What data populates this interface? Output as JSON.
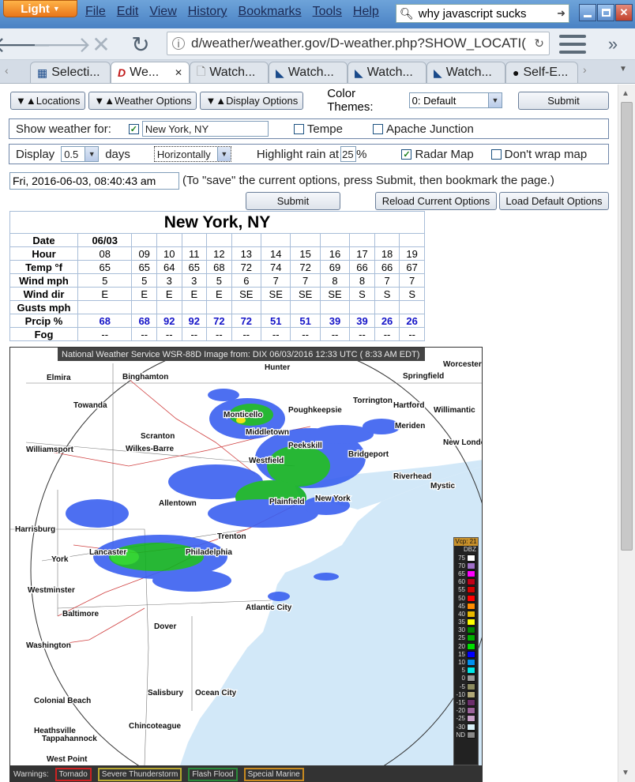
{
  "browser": {
    "theme_button": "Light",
    "menu": [
      "File",
      "Edit",
      "View",
      "History",
      "Bookmarks",
      "Tools",
      "Help"
    ],
    "search_text": "why javascript sucks",
    "url": "d/weather/weather.gov/D-weather.php?SHOW_LOCATI(",
    "tabs": [
      {
        "label": "Selecti...",
        "icon": "grid-icon"
      },
      {
        "label": "We...",
        "icon": "d-logo-icon",
        "active": true
      },
      {
        "label": "Watch...",
        "icon": "page-icon"
      },
      {
        "label": "Watch...",
        "icon": "trail-icon"
      },
      {
        "label": "Watch...",
        "icon": "trail-icon"
      },
      {
        "label": "Watch...",
        "icon": "trail-icon"
      },
      {
        "label": "Self-E...",
        "icon": "github-icon"
      }
    ]
  },
  "options": {
    "locations_btn": "▼▲Locations",
    "weather_options_btn": "▼▲Weather Options",
    "display_options_btn": "▼▲Display Options",
    "color_themes_label": "Color Themes:",
    "color_theme_value": "0: Default",
    "submit": "Submit",
    "show_weather_label": "Show weather for:",
    "location_value": "New York, NY",
    "loc_tempe": "Tempe",
    "loc_apache": "Apache Junction",
    "display_label": "Display",
    "days_value": "0.5",
    "days_label": "days",
    "orientation_value": "Horizontally",
    "highlight_label": "Highlight rain at",
    "highlight_value": "25",
    "percent": "%",
    "radar_map_label": "Radar Map",
    "dont_wrap_label": "Don't wrap map",
    "timestamp": "Fri, 2016-06-03, 08:40:43 am",
    "save_hint": "(To \"save\" the current options, press Submit, then bookmark the page.)",
    "submit2": "Submit",
    "reload_btn": "Reload Current Options",
    "load_default_btn": "Load Default Options"
  },
  "forecast": {
    "city": "New York, NY",
    "row_labels": [
      "Date",
      "Hour",
      "Temp °f",
      "Wind mph",
      "Wind dir",
      "Gusts mph",
      "Prcip %",
      "Fog"
    ],
    "date": "06/03",
    "hours": [
      "08",
      "09",
      "10",
      "11",
      "12",
      "13",
      "14",
      "15",
      "16",
      "17",
      "18",
      "19"
    ],
    "temp": [
      "65",
      "65",
      "64",
      "65",
      "68",
      "72",
      "74",
      "72",
      "69",
      "66",
      "66",
      "67"
    ],
    "wind_mph": [
      "5",
      "5",
      "3",
      "3",
      "5",
      "6",
      "7",
      "7",
      "8",
      "8",
      "7",
      "7"
    ],
    "wind_dir": [
      "E",
      "E",
      "E",
      "E",
      "E",
      "SE",
      "SE",
      "SE",
      "SE",
      "S",
      "S",
      "S"
    ],
    "gusts": [
      "",
      "",
      "",
      "",
      "",
      "",
      "",
      "",
      "",
      "",
      "",
      ""
    ],
    "precip": [
      "68",
      "68",
      "92",
      "92",
      "72",
      "72",
      "51",
      "51",
      "39",
      "39",
      "26",
      "26"
    ],
    "fog": [
      "--",
      "--",
      "--",
      "--",
      "--",
      "--",
      "--",
      "--",
      "--",
      "--",
      "--",
      "--"
    ]
  },
  "radar": {
    "header": "National Weather Service WSR-88D Image  from:  DIX  06/03/2016  12:33  UTC  ( 8:33 AM EDT)",
    "warnings_label": "Warnings:",
    "warnings": [
      {
        "label": "Tornado",
        "color": "#cc2222"
      },
      {
        "label": "Severe Thunderstorm",
        "color": "#b8a830"
      },
      {
        "label": "Flash Flood",
        "color": "#2a8a3a"
      },
      {
        "label": "Special Marine",
        "color": "#c88a20"
      }
    ],
    "legend_title": "Vcp: 21",
    "legend_unit": "DBZ",
    "legend": [
      {
        "v": "75",
        "c": "#ffffff"
      },
      {
        "v": "70",
        "c": "#a070c8"
      },
      {
        "v": "65",
        "c": "#ff00ff"
      },
      {
        "v": "60",
        "c": "#c00018"
      },
      {
        "v": "55",
        "c": "#d40000"
      },
      {
        "v": "50",
        "c": "#ff0000"
      },
      {
        "v": "45",
        "c": "#ff8c00"
      },
      {
        "v": "40",
        "c": "#e8b800"
      },
      {
        "v": "35",
        "c": "#ffff00"
      },
      {
        "v": "30",
        "c": "#008800"
      },
      {
        "v": "25",
        "c": "#00b000"
      },
      {
        "v": "20",
        "c": "#00e000"
      },
      {
        "v": "15",
        "c": "#0000ff"
      },
      {
        "v": "10",
        "c": "#0090f0"
      },
      {
        "v": "5",
        "c": "#00e8e8"
      },
      {
        "v": "0",
        "c": "#9a9a9a"
      },
      {
        "v": "-5",
        "c": "#8c8c60"
      },
      {
        "v": "-10",
        "c": "#b0a878"
      },
      {
        "v": "-15",
        "c": "#6c2e6c"
      },
      {
        "v": "-20",
        "c": "#9c649c"
      },
      {
        "v": "-25",
        "c": "#c8a0c8"
      },
      {
        "v": "-30",
        "c": "#d8f0f8"
      },
      {
        "v": "ND",
        "c": "#888888"
      }
    ],
    "cities": [
      "Hunter",
      "Worcester",
      "Elmira",
      "Binghamton",
      "Springfield",
      "Torrington",
      "Hartford",
      "Willimantic",
      "Towanda",
      "Monticello",
      "Poughkeepsie",
      "Meriden",
      "Scranton",
      "Middletown",
      "New London",
      "Williamsport",
      "Wilkes-Barre",
      "Peekskill",
      "Bridgeport",
      "Westfield",
      "Riverhead",
      "Allentown",
      "Mystic",
      "Plainfield",
      "New York",
      "Harrisburg",
      "Trenton",
      "Lancaster",
      "York",
      "Philadelphia",
      "Westminster",
      "Atlantic City",
      "Baltimore",
      "Dover",
      "Washington",
      "Salisbury",
      "Ocean City",
      "Colonial Beach",
      "Chincoteague",
      "Heathsville",
      "Tappahannock",
      "West Point"
    ]
  }
}
